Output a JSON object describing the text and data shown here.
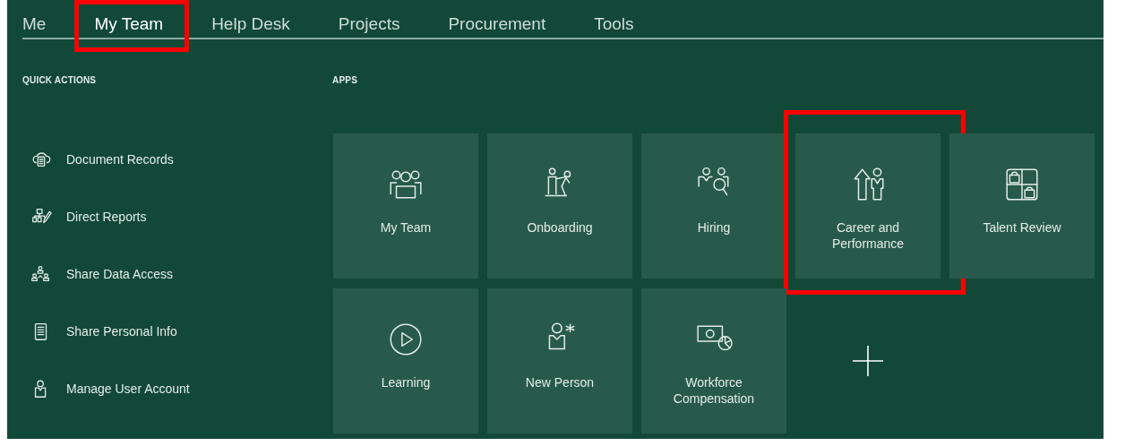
{
  "tabs": [
    {
      "label": "Me",
      "selected": false,
      "highlighted": false
    },
    {
      "label": "My Team",
      "selected": true,
      "highlighted": true
    },
    {
      "label": "Help Desk",
      "selected": false,
      "highlighted": false
    },
    {
      "label": "Projects",
      "selected": false,
      "highlighted": false
    },
    {
      "label": "Procurement",
      "selected": false,
      "highlighted": false
    },
    {
      "label": "Tools",
      "selected": false,
      "highlighted": false
    }
  ],
  "quick_actions": {
    "heading": "QUICK ACTIONS",
    "items": [
      {
        "label": "Document Records"
      },
      {
        "label": "Direct Reports"
      },
      {
        "label": "Share Data Access"
      },
      {
        "label": "Share Personal Info"
      },
      {
        "label": "Manage User Account"
      }
    ]
  },
  "apps": {
    "heading": "APPS",
    "tiles": [
      {
        "kind": "app",
        "label": "My Team",
        "highlighted": false
      },
      {
        "kind": "app",
        "label": "Onboarding",
        "highlighted": false
      },
      {
        "kind": "app",
        "label": "Hiring",
        "highlighted": false
      },
      {
        "kind": "app",
        "label": "Career and Performance",
        "highlighted": true
      },
      {
        "kind": "app",
        "label": "Talent Review",
        "highlighted": false
      },
      {
        "kind": "app",
        "label": "Learning",
        "highlighted": false
      },
      {
        "kind": "app",
        "label": "New Person",
        "highlighted": false
      },
      {
        "kind": "app",
        "label": "Workforce Compensation",
        "highlighted": false
      },
      {
        "kind": "add"
      }
    ]
  }
}
